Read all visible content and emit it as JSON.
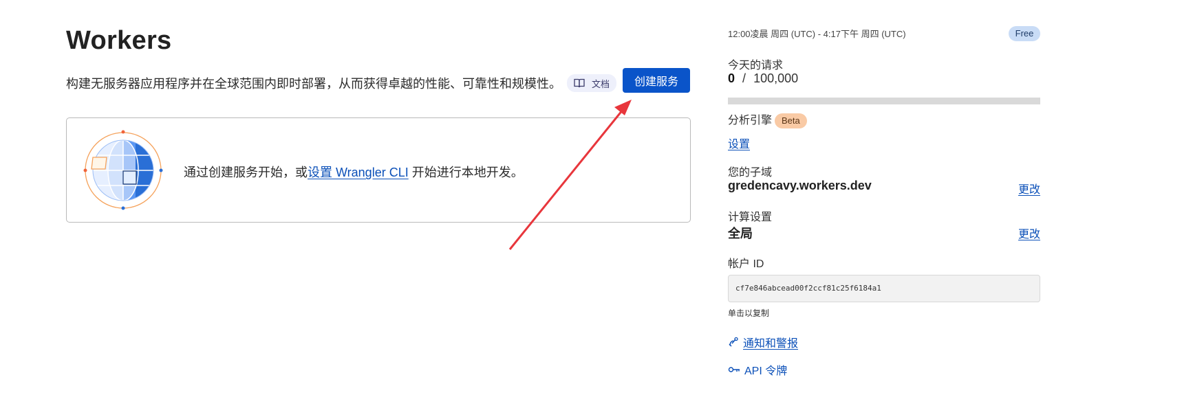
{
  "main": {
    "title": "Workers",
    "subtitle": "构建无服务器应用程序并在全球范围内即时部署，从而获得卓越的性能、可靠性和规模性。",
    "docs_label": "文档",
    "create_button": "创建服务",
    "card": {
      "text_before": "通过创建服务开始，或",
      "link_text": "设置 Wrangler CLI",
      "text_after": " 开始进行本地开发。"
    }
  },
  "sidebar": {
    "time_range": "12:00凌晨 周四 (UTC) - 4:17下午 周四 (UTC)",
    "plan_badge": "Free",
    "requests": {
      "label": "今天的请求",
      "used": "0",
      "separator": "/",
      "limit": "100,000",
      "fraction": 0
    },
    "analytics": {
      "label": "分析引擎",
      "badge": "Beta",
      "link": "设置"
    },
    "subdomain": {
      "label": "您的子域",
      "value": "gredencavy.workers.dev",
      "change": "更改"
    },
    "compute": {
      "label": "计算设置",
      "value": "全局",
      "change": "更改"
    },
    "account": {
      "label": "帐户 ID",
      "id": "cf7e846abcead00f2ccf81c25f6184a1",
      "hint": "单击以复制"
    },
    "links": {
      "notifications": "通知和警报",
      "api_tokens": "API 令牌"
    }
  },
  "colors": {
    "primary": "#0a54c9",
    "link": "#0a4fb8",
    "free_badge": "#c9dcf6",
    "beta_badge": "#f9caa5",
    "arrow": "#e8363c"
  },
  "icons": {
    "docs": "book-icon",
    "globe": "globe-illustration",
    "notifications": "satellite-icon",
    "api": "key-icon"
  }
}
